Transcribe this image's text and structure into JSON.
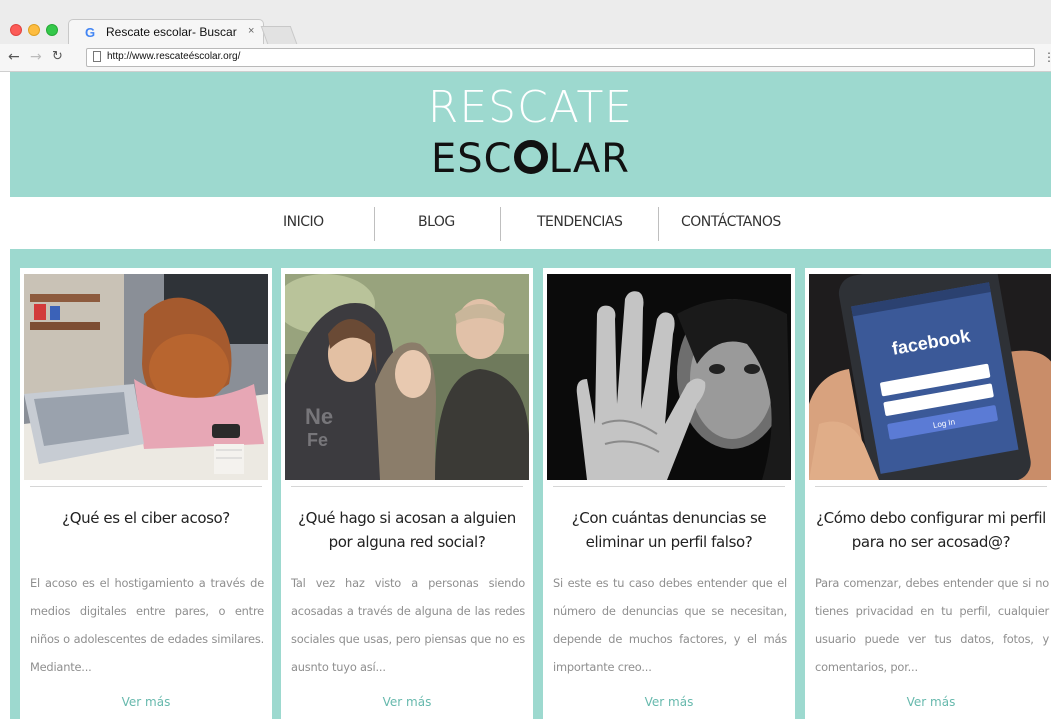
{
  "browser": {
    "tab_favicon": "G",
    "tab_title": "Rescate escolar- Buscar",
    "tab_close": "×",
    "url": "http://www.rescateéscolar.org/",
    "icons": [
      "back-arrow-icon",
      "forward-arrow-icon",
      "reload-icon",
      "page-icon",
      "menu-dots-icon"
    ]
  },
  "site": {
    "logo_line1": "RESCATE",
    "logo_line2_before": "ESC",
    "logo_line2_after": "LAR",
    "accent_color": "#9dd9cf",
    "link_color": "#67b9ad"
  },
  "nav": {
    "items": [
      {
        "label": "INICIO"
      },
      {
        "label": "BLOG"
      },
      {
        "label": "TENDENCIAS"
      },
      {
        "label": "CONTÁCTANOS"
      }
    ]
  },
  "cards": [
    {
      "image": "girl-with-laptop-photo",
      "title": "¿Qué es el ciber acoso?",
      "body": "El acoso es el hostigamiento a través de medios digitales entre pares, o entre niños o adolescentes de edades similares. Mediante...",
      "more": "Ver más"
    },
    {
      "image": "teens-group-photo",
      "title": "¿Qué hago si acosan a alguien por alguna red social?",
      "body": "Tal vez haz visto a personas siendo acosadas a través de alguna de las redes sociales que usas, pero piensas que no es ausnto tuyo así...",
      "more": "Ver más"
    },
    {
      "image": "stop-hand-photo",
      "title": "¿Con cuántas denuncias se eliminar un perfil falso?",
      "body": "Si este es tu caso debes entender que el número de denuncias que se necesitan, depende de muchos factores, y el más importante creo...",
      "more": "Ver más"
    },
    {
      "image": "facebook-phone-photo",
      "title": "¿Cómo debo configurar mi perfil para no ser acosad@?",
      "body": "Para comenzar, debes entender que si no tienes privacidad en tu perfil, cualquier usuario puede ver tus datos, fotos, y comentarios, por...",
      "more": "Ver más",
      "phone_text": "facebook",
      "phone_button": "Log In"
    }
  ]
}
